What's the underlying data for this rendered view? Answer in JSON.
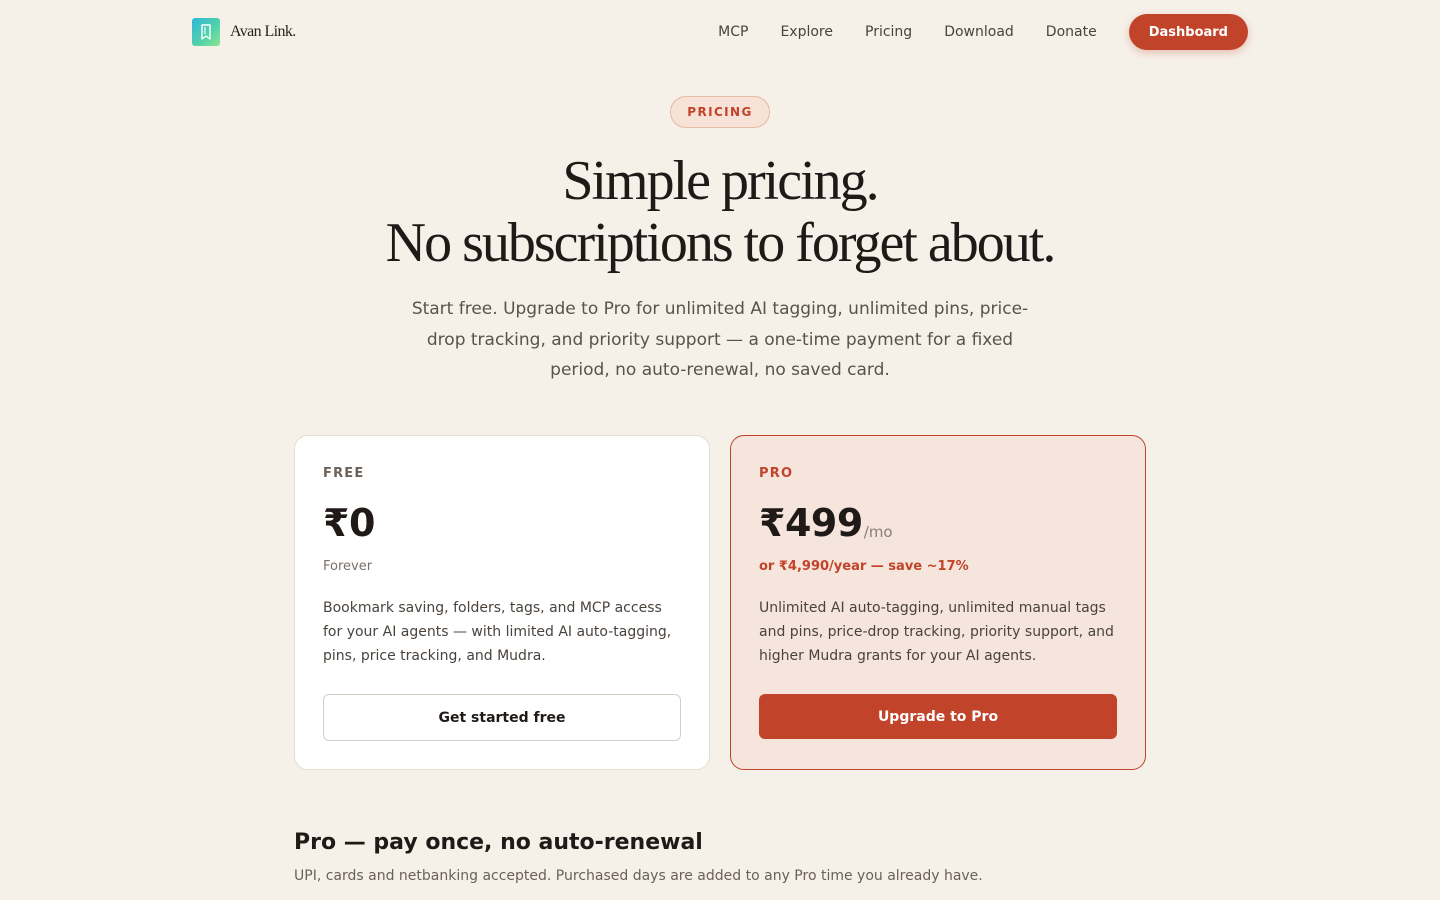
{
  "brand": {
    "name": "Avan Link.",
    "logo_icon": "bookmark-logo-icon"
  },
  "nav": {
    "links": [
      "MCP",
      "Explore",
      "Pricing",
      "Download",
      "Donate"
    ],
    "cta": "Dashboard"
  },
  "hero": {
    "badge": "PRICING",
    "title_line1": "Simple pricing.",
    "title_line2": "No subscriptions to forget about.",
    "subtitle": "Start free. Upgrade to Pro for unlimited AI tagging, unlimited pins, price-drop tracking, and priority support — a one-time payment for a fixed period, no auto-renewal, no saved card."
  },
  "plans": {
    "free": {
      "label": "FREE",
      "price": "₹0",
      "note": "Forever",
      "description": "Bookmark saving, folders, tags, and MCP access for your AI agents — with limited AI auto-tagging, pins, price tracking, and Mudra.",
      "button": "Get started free"
    },
    "pro": {
      "label": "PRO",
      "price": "₹499",
      "price_unit": "/mo",
      "note": "or ₹4,990/year — save ~17%",
      "description": "Unlimited AI auto-tagging, unlimited manual tags and pins, price-drop tracking, priority support, and higher Mudra grants for your AI agents.",
      "button": "Upgrade to Pro"
    }
  },
  "section": {
    "title": "Pro — pay once, no auto-renewal",
    "text": "UPI, cards and netbanking accepted. Purchased days are added to any Pro time you already have."
  },
  "colors": {
    "background": "#f5f0e8",
    "accent": "#c1432a",
    "pro_card_bg": "#f5e5dc",
    "text": "#1f1a17"
  }
}
